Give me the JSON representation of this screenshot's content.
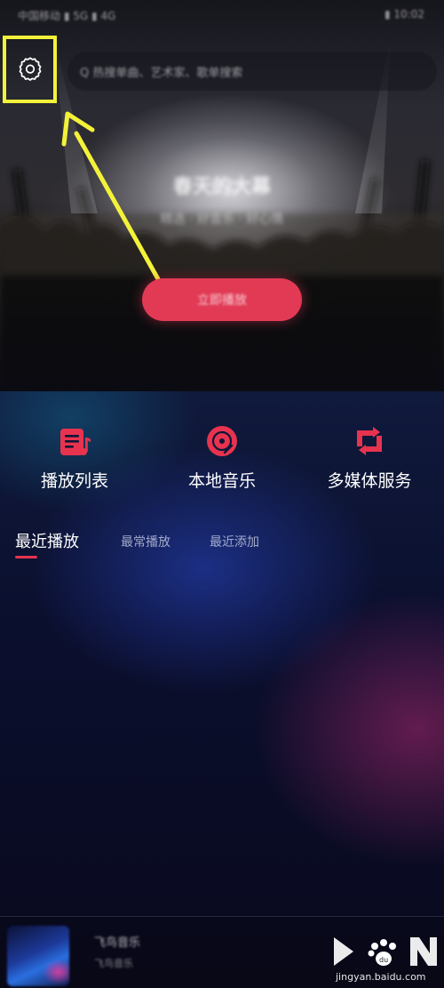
{
  "status_bar": {
    "left_text": "中国移动 ▮ 5G ▮ 4G",
    "right_text": "▮ 10:02"
  },
  "header": {
    "settings_icon": "gear-icon",
    "search": {
      "placeholder": "Q  热搜单曲、艺术家、歌单搜索"
    }
  },
  "hero": {
    "title": "春天的大幕",
    "subtitle": "精选 · 好音乐 · 好心情",
    "cta_label": "立即播放"
  },
  "entries": [
    {
      "label": "播放列表",
      "icon": "playlist-icon"
    },
    {
      "label": "本地音乐",
      "icon": "vinyl-disc-icon"
    },
    {
      "label": "多媒体服务",
      "icon": "media-swap-icon"
    }
  ],
  "tabs": [
    {
      "label": "最近播放",
      "active": true
    },
    {
      "label": "最常播放",
      "active": false
    },
    {
      "label": "最近添加",
      "active": false
    }
  ],
  "mini_player": {
    "title": "飞鸟音乐",
    "artist": "飞鸟音乐"
  },
  "watermark": {
    "text": "jingyan.baidu.com"
  },
  "colors": {
    "accent": "#e23a55",
    "highlight": "#f3f23a",
    "tab_indicator": "#e8334f"
  }
}
